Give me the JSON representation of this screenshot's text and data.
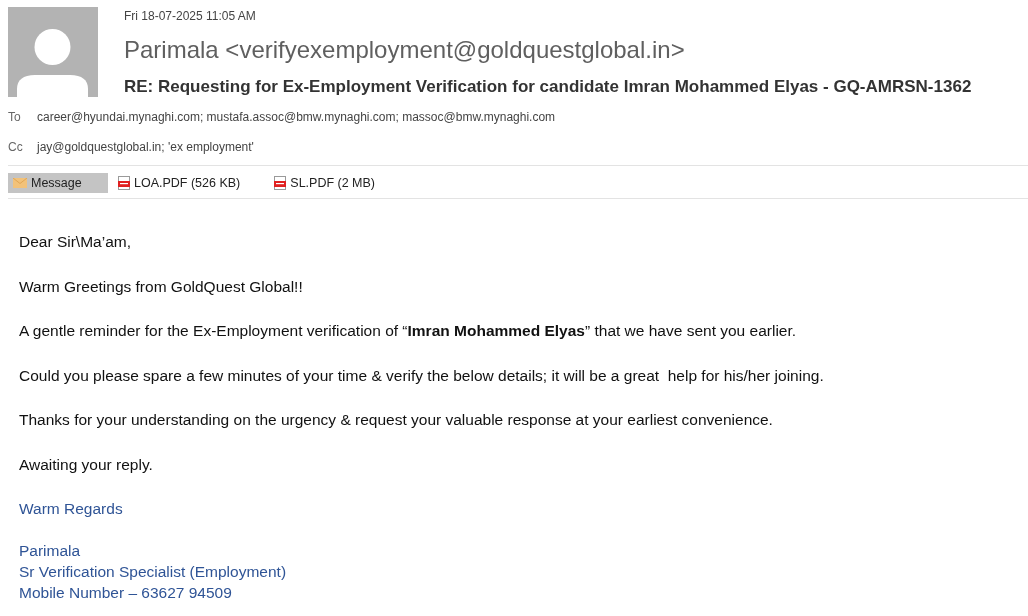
{
  "message_header": {
    "date": "Fri 18-07-2025 11:05 AM",
    "sender": "Parimala <verifyexemployment@goldquestglobal.in>",
    "subject": "RE: Requesting for Ex-Employment Verification for candidate Imran Mohammed Elyas - GQ-AMRSN-1362",
    "recipients": [
      {
        "label": "To",
        "value": "career@hyundai.mynaghi.com; mustafa.assoc@bmw.mynaghi.com; massoc@bmw.mynaghi.com"
      },
      {
        "label": "Cc",
        "value": "jay@goldquestglobal.in; 'ex employment'"
      }
    ]
  },
  "attachments": [
    {
      "kind": "message",
      "label": "Message",
      "selected": true
    },
    {
      "kind": "pdf",
      "label": "LOA.PDF (526 KB)",
      "selected": false
    },
    {
      "kind": "pdf",
      "label": "SL.PDF (2 MB)",
      "selected": false
    }
  ],
  "body": {
    "paragraphs": [
      "Dear Sir\\Ma’am,",
      "Warm Greetings from GoldQuest Global!!",
      "A gentle reminder for the Ex-Employment verification of “**Imran Mohammed Elyas**” that we have sent you earlier.",
      "Could you please spare a few minutes of your time & verify the below details; it will be a great  help for his/her joining.",
      "Thanks for your understanding on the urgency & request your valuable response at your earliest convenience.",
      "Awaiting your reply."
    ],
    "signature": {
      "closing": "Warm Regards",
      "lines": [
        "Parimala",
        "Sr Verification Specialist (Employment)",
        "Mobile Number – 63627 94509"
      ]
    }
  }
}
